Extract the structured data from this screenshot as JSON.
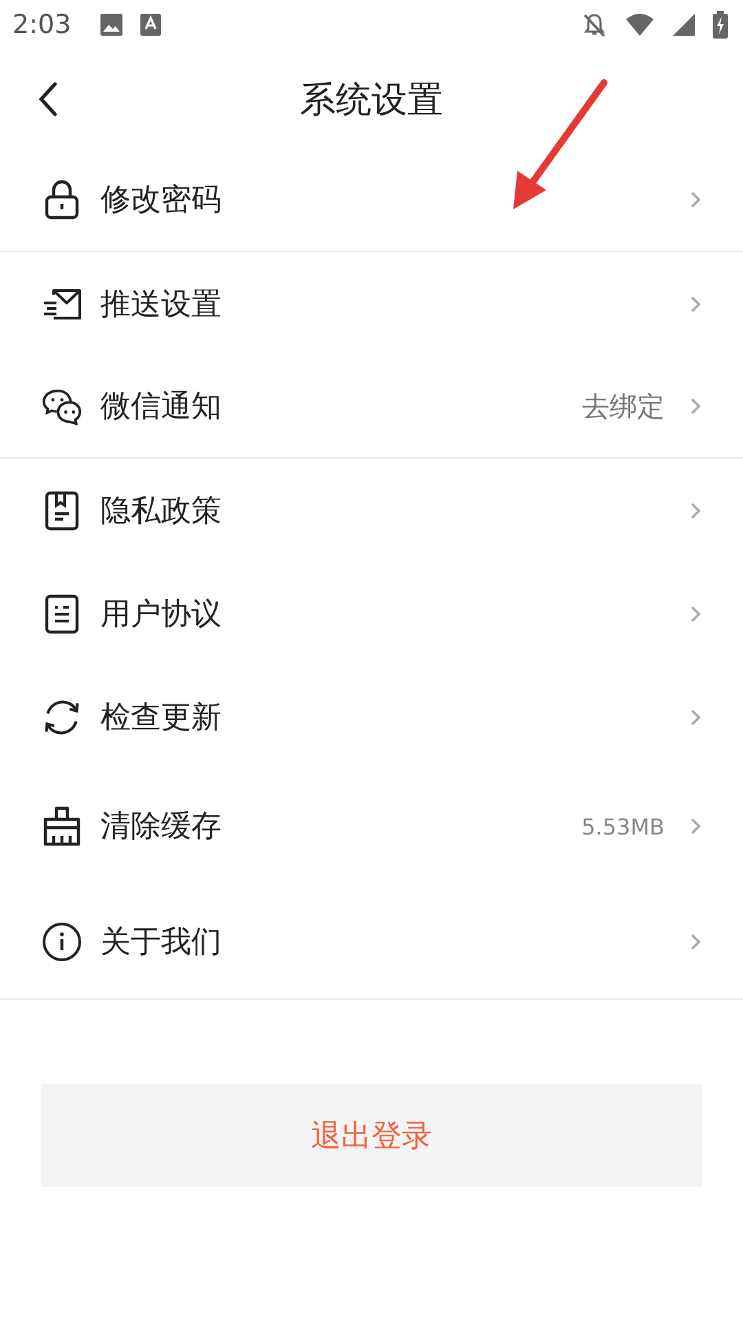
{
  "status_bar": {
    "time": "2:03"
  },
  "header": {
    "title": "系统设置"
  },
  "items": [
    {
      "kind": "lock",
      "label": "修改密码",
      "divider": true
    },
    {
      "kind": "mail",
      "label": "推送设置",
      "divider": false
    },
    {
      "kind": "wechat",
      "label": "微信通知",
      "value": "去绑定",
      "divider": true
    },
    {
      "kind": "privacy",
      "label": "隐私政策",
      "divider": false
    },
    {
      "kind": "doc",
      "label": "用户协议",
      "divider": false
    },
    {
      "kind": "refresh",
      "label": "检查更新",
      "divider": false
    },
    {
      "kind": "broom",
      "label": "清除缓存",
      "value": "5.53MB",
      "divider": false
    },
    {
      "kind": "info",
      "label": "关于我们",
      "divider": true
    }
  ],
  "logout_button": {
    "label": "退出登录"
  }
}
